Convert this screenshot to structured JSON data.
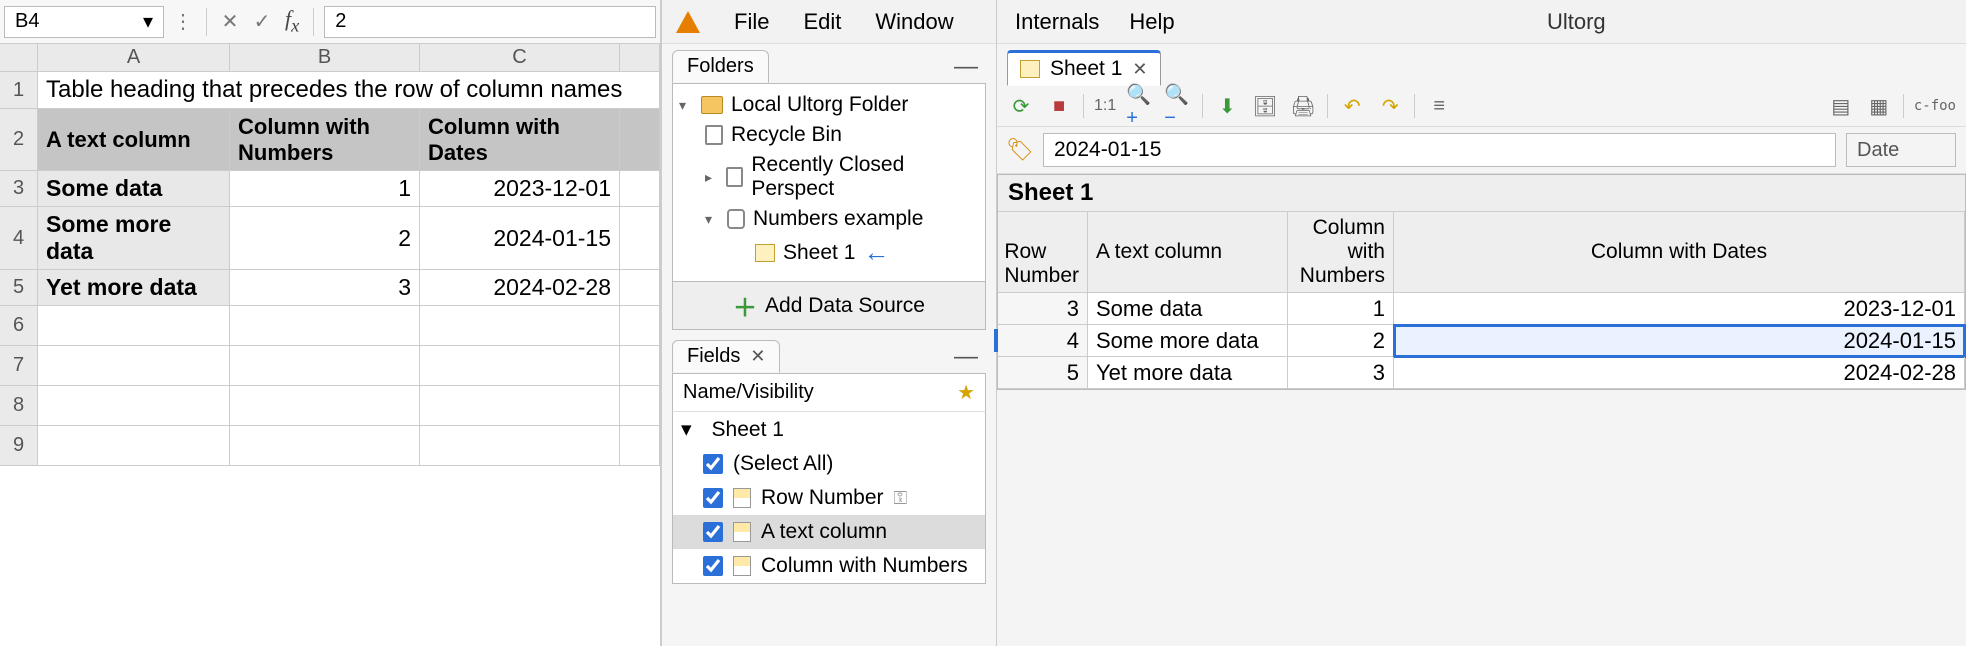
{
  "left": {
    "cell_ref": "B4",
    "formula_value": "2",
    "columns": [
      "A",
      "B",
      "C"
    ],
    "heading": "Table heading that precedes the row of column names",
    "headers": [
      "A text column",
      "Column with Numbers",
      "Column with Dates"
    ],
    "rows": [
      {
        "a": "Some data",
        "b": "1",
        "c": "2023-12-01"
      },
      {
        "a": "Some more data",
        "b": "2",
        "c": "2024-01-15"
      },
      {
        "a": "Yet more data",
        "b": "3",
        "c": "2024-02-28"
      }
    ],
    "row_labels": [
      "1",
      "2",
      "3",
      "4",
      "5",
      "6",
      "7",
      "8",
      "9"
    ]
  },
  "app": {
    "title": "Ultorg",
    "menu": [
      "File",
      "Edit",
      "Window",
      "Internals",
      "Help"
    ]
  },
  "folders": {
    "tab": "Folders",
    "root": "Local Ultorg Folder",
    "recycle": "Recycle Bin",
    "recent": "Recently Closed Perspect",
    "db": "Numbers example",
    "sheet": "Sheet 1",
    "add": "Add Data Source"
  },
  "fields": {
    "tab": "Fields",
    "header": "Name/Visibility",
    "sheet": "Sheet 1",
    "select_all": "(Select All)",
    "items": [
      {
        "label": "Row Number",
        "key": true,
        "checked": true
      },
      {
        "label": "A text column",
        "key": false,
        "checked": true,
        "selected": true
      },
      {
        "label": "Column with Numbers",
        "key": false,
        "checked": true
      }
    ]
  },
  "right": {
    "tab": "Sheet 1",
    "toolbar_11": "1:1",
    "toolbar_foo": "foo",
    "value_input": "2024-01-15",
    "value_type": "Date",
    "grid_title": "Sheet 1",
    "headers": {
      "rn": "Row Number",
      "tc": "A text column",
      "nc": "Column with Numbers",
      "dc": "Column with Dates"
    },
    "rows": [
      {
        "rn": "3",
        "tc": "Some data",
        "nc": "1",
        "dc": "2023-12-01",
        "sel": false
      },
      {
        "rn": "4",
        "tc": "Some more data",
        "nc": "2",
        "dc": "2024-01-15",
        "sel": true
      },
      {
        "rn": "5",
        "tc": "Yet more data",
        "nc": "3",
        "dc": "2024-02-28",
        "sel": false
      }
    ]
  },
  "chart_data": {
    "type": "table",
    "title": "Sheet 1",
    "columns": [
      "Row Number",
      "A text column",
      "Column with Numbers",
      "Column with Dates"
    ],
    "rows": [
      [
        3,
        "Some data",
        1,
        "2023-12-01"
      ],
      [
        4,
        "Some more data",
        2,
        "2024-01-15"
      ],
      [
        5,
        "Yet more data",
        3,
        "2024-02-28"
      ]
    ]
  }
}
